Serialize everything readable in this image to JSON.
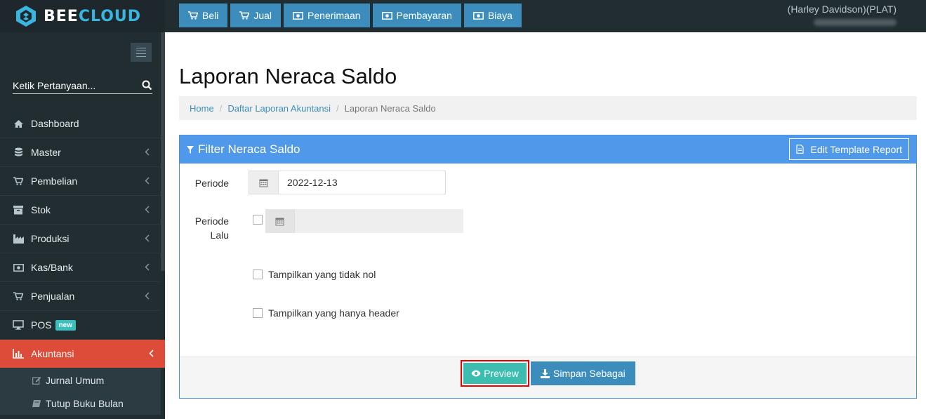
{
  "brand": {
    "part1": "BEE",
    "part2": "CLOUD"
  },
  "topnav": [
    {
      "label": "Beli",
      "icon": "cart-icon"
    },
    {
      "label": "Jual",
      "icon": "cart-icon"
    },
    {
      "label": "Penerimaan",
      "icon": "money-icon"
    },
    {
      "label": "Pembayaran",
      "icon": "money-icon"
    },
    {
      "label": "Biaya",
      "icon": "money-icon"
    }
  ],
  "user": {
    "company": "(Harley Davidson)(PLAT)"
  },
  "sidebar": {
    "search_placeholder": "Ketik Pertanyaan...",
    "items": [
      {
        "label": "Dashboard",
        "icon": "home-icon"
      },
      {
        "label": "Master",
        "icon": "database-icon"
      },
      {
        "label": "Pembelian",
        "icon": "cart-icon"
      },
      {
        "label": "Stok",
        "icon": "archive-icon"
      },
      {
        "label": "Produksi",
        "icon": "industry-icon"
      },
      {
        "label": "Kas/Bank",
        "icon": "money-icon"
      },
      {
        "label": "Penjualan",
        "icon": "cart-icon"
      },
      {
        "label": "POS",
        "icon": "monitor-icon",
        "badge": "new"
      },
      {
        "label": "Akuntansi",
        "icon": "bar-chart-icon",
        "active": true
      }
    ],
    "subitems": [
      {
        "label": "Jurnal Umum",
        "icon": "edit-icon"
      },
      {
        "label": "Tutup Buku Bulan",
        "icon": "book-icon"
      }
    ]
  },
  "page": {
    "title": "Laporan Neraca Saldo",
    "breadcrumb": [
      "Home",
      "Daftar Laporan Akuntansi",
      "Laporan Neraca Saldo"
    ]
  },
  "filter": {
    "title": "Filter Neraca Saldo",
    "edit_template_label": "Edit Template Report",
    "periode_label": "Periode",
    "periode_value": "2022-12-13",
    "periode_lalu_label_1": "Periode",
    "periode_lalu_label_2": "Lalu",
    "periode_lalu_value": "",
    "periode_lalu_checked": false,
    "option_nonzero": "Tampilkan yang tidak nol",
    "option_nonzero_checked": false,
    "option_header": "Tampilkan yang hanya header",
    "option_header_checked": false,
    "preview_label": "Preview",
    "save_label": "Simpan Sebagai"
  },
  "colors": {
    "topbar": "#222d32",
    "accent_blue": "#3c8dbc",
    "panel_head": "#4f98ea",
    "active_menu": "#dd4b39",
    "preview_green": "#3dbdb0",
    "highlight_border": "#ee0000"
  }
}
